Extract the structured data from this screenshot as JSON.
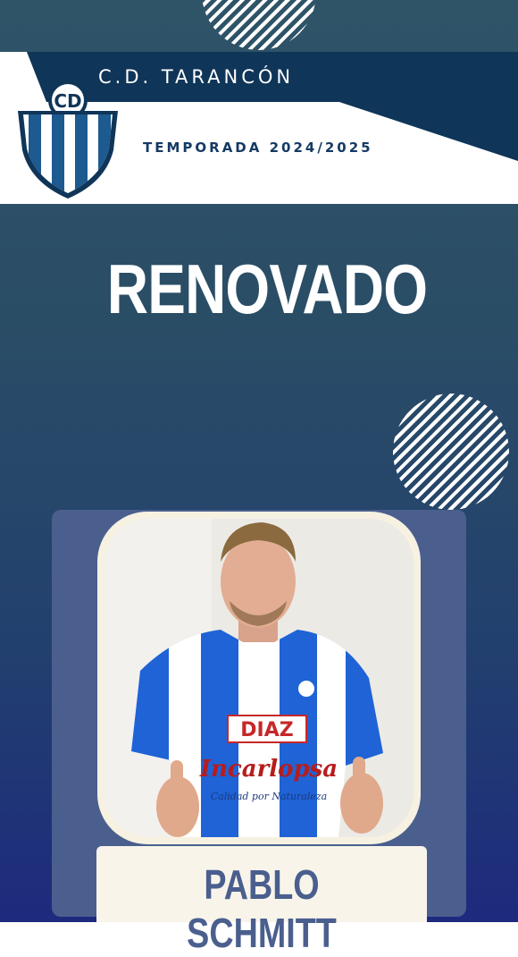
{
  "header": {
    "club_name": "C.D. TARANCÓN",
    "season": "TEMPORADA 2024/2025",
    "crest_letters": "CD"
  },
  "headline": "RENOVADO",
  "player": {
    "name": "PABLO SCHMITT",
    "shirt_sponsor_1": "DIAZ",
    "shirt_sponsor_2": "Incarlopsa",
    "shirt_tagline": "Calidad por Naturaleza"
  },
  "colors": {
    "navy": "#0f3558",
    "white": "#ffffff",
    "card": "#4a5f8e",
    "cream": "#f8f4ea",
    "kit_blue": "#1f63d6"
  }
}
